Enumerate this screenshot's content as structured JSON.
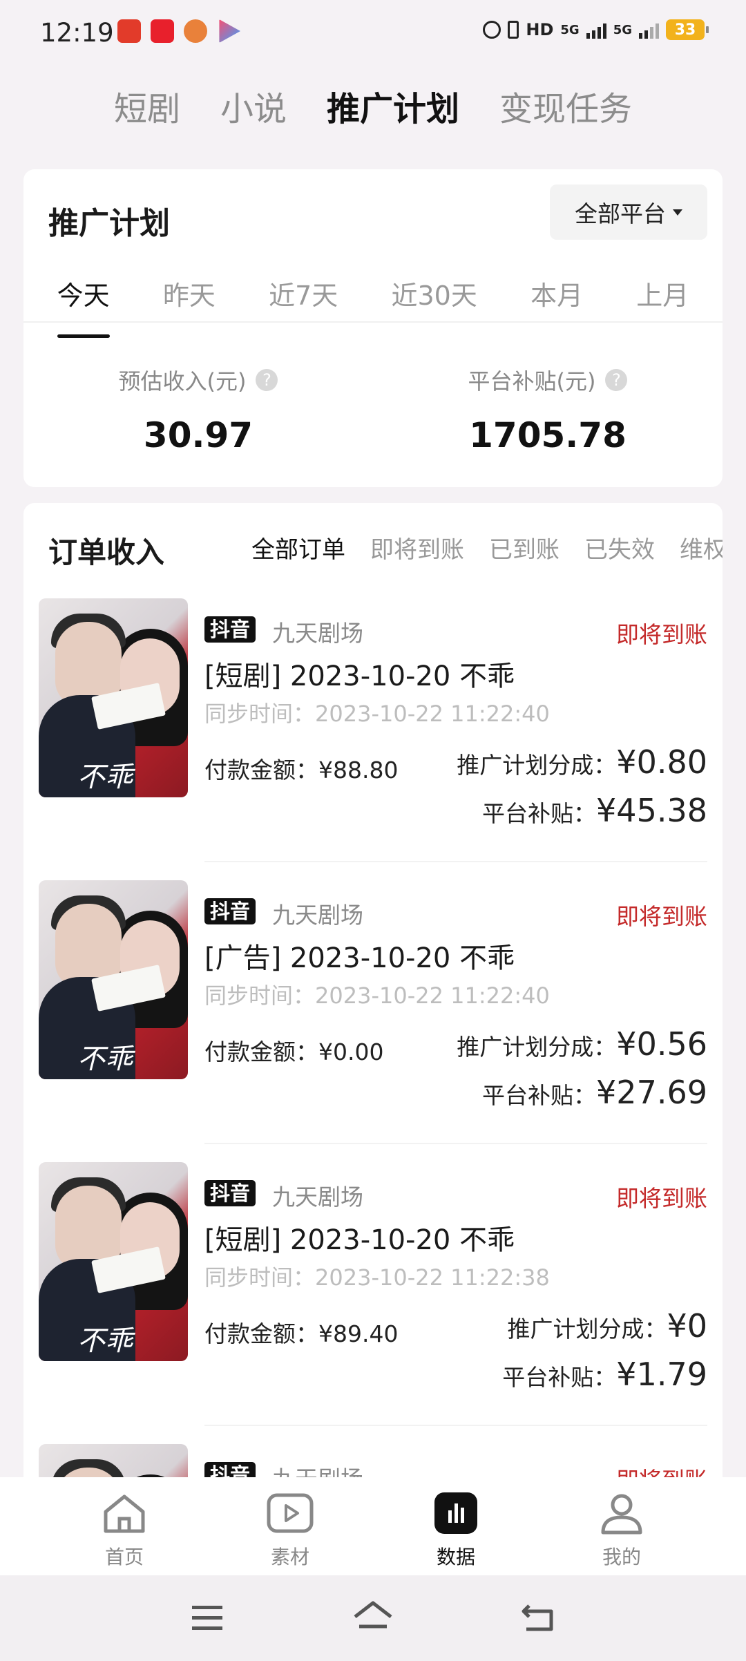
{
  "status_bar": {
    "time": "12:19",
    "battery": "33",
    "net": "HD",
    "sig1": "5G",
    "sig2": "5G"
  },
  "top_tabs": [
    "短剧",
    "小说",
    "推广计划",
    "变现任务"
  ],
  "plan_card": {
    "title": "推广计划",
    "platform_button": "全部平台",
    "date_tabs": [
      "今天",
      "昨天",
      "近7天",
      "近30天",
      "本月",
      "上月"
    ],
    "stats": [
      {
        "label": "预估收入(元)",
        "value": "30.97"
      },
      {
        "label": "平台补贴(元)",
        "value": "1705.78"
      }
    ]
  },
  "orders_card": {
    "title": "订单收入",
    "filters": [
      "全部订单",
      "即将到账",
      "已到账",
      "已失效",
      "维权"
    ],
    "orders": [
      {
        "platform": "抖音",
        "source": "九天剧场",
        "status": "即将到账",
        "title": "[短剧] 2023-10-20 不乖",
        "sync": "同步时间：2023-10-22 11:22:40",
        "paid_label": "付款金额：",
        "paid": "¥88.80",
        "share_label": "推广计划分成：",
        "share": "¥0.80",
        "subsidy_label": "平台补贴：",
        "subsidy": "¥45.38"
      },
      {
        "platform": "抖音",
        "source": "九天剧场",
        "status": "即将到账",
        "title": "[广告] 2023-10-20 不乖",
        "sync": "同步时间：2023-10-22 11:22:40",
        "paid_label": "付款金额：",
        "paid": "¥0.00",
        "share_label": "推广计划分成：",
        "share": "¥0.56",
        "subsidy_label": "平台补贴：",
        "subsidy": "¥27.69"
      },
      {
        "platform": "抖音",
        "source": "九天剧场",
        "status": "即将到账",
        "title": "[短剧] 2023-10-20 不乖",
        "sync": "同步时间：2023-10-22 11:22:38",
        "paid_label": "付款金额：",
        "paid": "¥89.40",
        "share_label": "推广计划分成：",
        "share": "¥0",
        "subsidy_label": "平台补贴：",
        "subsidy": "¥1.79"
      },
      {
        "platform": "抖音",
        "source": "九天剧场",
        "status": "即将到账"
      }
    ],
    "poster_text": "不乖"
  },
  "bottom_nav": [
    "首页",
    "素材",
    "数据",
    "我的"
  ]
}
